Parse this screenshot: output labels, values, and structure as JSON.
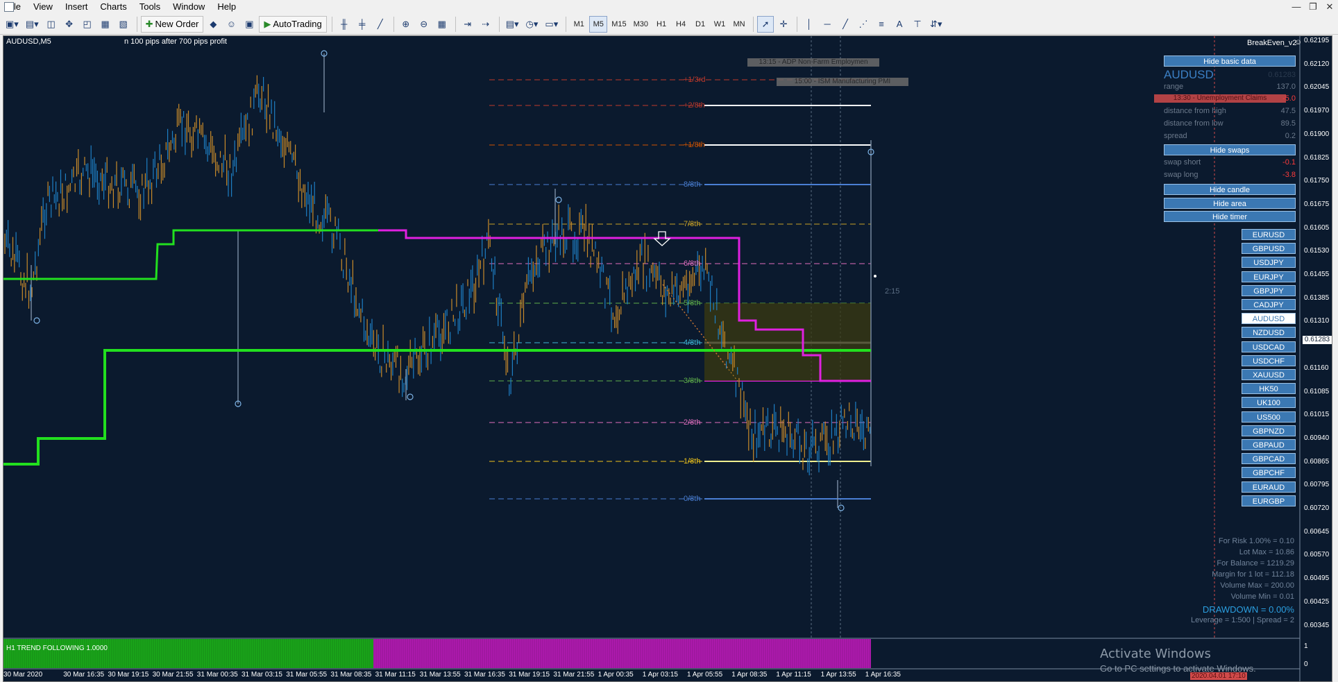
{
  "menu": {
    "items": [
      "File",
      "View",
      "Insert",
      "Charts",
      "Tools",
      "Window",
      "Help"
    ],
    "window_controls": [
      "—",
      "❐",
      "✕"
    ]
  },
  "toolbar": {
    "new_order": "New Order",
    "autotrading": "AutoTrading",
    "timeframes": [
      "M1",
      "M5",
      "M15",
      "M30",
      "H1",
      "H4",
      "D1",
      "W1",
      "MN"
    ],
    "selected_timeframe": "M5",
    "text_tool": "A"
  },
  "chart": {
    "symbol_label": "AUDUSD,M5",
    "comment": "n 100 pips after 700 pips profit",
    "indicator_name": "BreakEven_v2",
    "timer": "2:15",
    "news": [
      "13:15 - ADP Non-Farm Employmen",
      "15:00 - ISM Manufacturing PMI",
      "13:30 - Unemployment Claims"
    ],
    "levels": [
      {
        "label": "+1/3rd",
        "color": "#c0392b"
      },
      {
        "label": "+2/8th",
        "color": "#c0392b"
      },
      {
        "label": "+1/8th",
        "color": "#d35400"
      },
      {
        "label": "8/8th",
        "color": "#4a7fd4"
      },
      {
        "label": "7/8th",
        "color": "#c9a227"
      },
      {
        "label": "6/8th",
        "color": "#e26fbf"
      },
      {
        "label": "5/8th",
        "color": "#5fb04a"
      },
      {
        "label": "4/8th",
        "color": "#3fb7d8"
      },
      {
        "label": "3/8th",
        "color": "#5fb04a"
      },
      {
        "label": "2/8th",
        "color": "#e26fbf"
      },
      {
        "label": "1/8th",
        "color": "#f0c419"
      },
      {
        "label": "0/8th",
        "color": "#4a7fd4"
      }
    ],
    "price_axis": [
      "0.62195",
      "0.62120",
      "0.62045",
      "0.61970",
      "0.61900",
      "0.61825",
      "0.61750",
      "0.61675",
      "0.61605",
      "0.61530",
      "0.61455",
      "0.61385",
      "0.61310",
      "0.61283",
      "0.61160",
      "0.61085",
      "0.61015",
      "0.60940",
      "0.60865",
      "0.60795",
      "0.60720",
      "0.60645",
      "0.60570",
      "0.60495",
      "0.60425",
      "0.60345"
    ],
    "current_price": "0.61283",
    "time_axis": [
      "30 Mar 2020",
      "30 Mar 16:35",
      "30 Mar 19:15",
      "30 Mar 21:55",
      "31 Mar 00:35",
      "31 Mar 03:15",
      "31 Mar 05:55",
      "31 Mar 08:35",
      "31 Mar 11:15",
      "31 Mar 13:55",
      "31 Mar 16:35",
      "31 Mar 19:15",
      "31 Mar 21:55",
      "1 Apr 00:35",
      "1 Apr 03:15",
      "1 Apr 05:55",
      "1 Apr 08:35",
      "1 Apr 11:15",
      "1 Apr 13:55",
      "1 Apr 16:35"
    ],
    "time_cursor_label": "2020.04.01 17:10",
    "subwindow_label": "H1 TREND FOLLOWING 1.0000",
    "subwindow_axis": [
      "1",
      "0"
    ]
  },
  "panel": {
    "hide_basic": "Hide basic data",
    "symbol": "AUDUSD",
    "symbol_price": "0.61283",
    "rows": [
      {
        "label": "range",
        "value": "137.0",
        "red": false
      },
      {
        "label": "",
        "value": "-5.0",
        "red": true
      },
      {
        "label": "distance from high",
        "value": "47.5",
        "red": false
      },
      {
        "label": "distance from low",
        "value": "89.5",
        "red": false
      },
      {
        "label": "spread",
        "value": "0.2",
        "red": false
      }
    ],
    "hide_swaps": "Hide swaps",
    "swaps": [
      {
        "label": "swap short",
        "value": "-0.1"
      },
      {
        "label": "swap long",
        "value": "-3.8"
      }
    ],
    "hide_candle": "Hide candle",
    "hide_area": "Hide area",
    "hide_timer": "Hide timer",
    "symbols": [
      "EURUSD",
      "GBPUSD",
      "USDJPY",
      "EURJPY",
      "GBPJPY",
      "CADJPY",
      "AUDUSD",
      "NZDUSD",
      "USDCAD",
      "USDCHF",
      "XAUUSD",
      "HK50",
      "UK100",
      "US500",
      "GBPNZD",
      "GBPAUD",
      "GBPCAD",
      "GBPCHF",
      "EURAUD",
      "EURGBP"
    ],
    "selected_symbol": "AUDUSD"
  },
  "money_mgmt": [
    "For Risk 1.00% = 0.10",
    "Lot Max = 10.86",
    "For Balance = 1219.29",
    "Margin for 1 lot = 112.18",
    "Volume Max = 200.00",
    "Volume Min = 0.01"
  ],
  "drawdown": "DRAWDOWN =  0.00%",
  "leverage": "Leverage = 1:500 | Spread = 2",
  "watermark": {
    "title": "Activate Windows",
    "subtitle": "Go to PC settings to activate Windows."
  },
  "colors": {
    "chart_bg": "#0b1a2e",
    "up_candle": "#1e7fc4",
    "down_candle": "#c98b2a",
    "green_line": "#22e01f",
    "magenta_line": "#e020e0",
    "panel_button": "#3b78b3"
  }
}
